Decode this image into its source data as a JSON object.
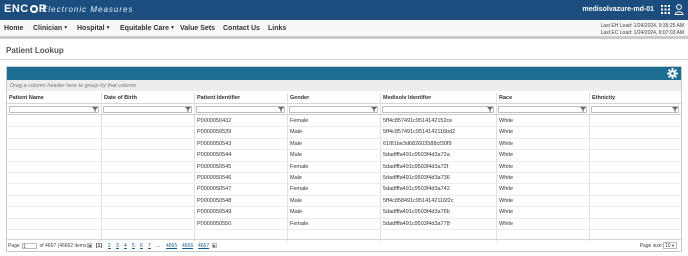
{
  "app": {
    "logo": "ENC",
    "logo_tail": "R",
    "subtitle": "Electronic Measures",
    "tenant": "medisolvazure-md-01"
  },
  "nav": {
    "items": [
      {
        "label": "Home",
        "has_caret": false
      },
      {
        "label": "Clinician",
        "has_caret": true
      },
      {
        "label": "Hospital",
        "has_caret": true
      },
      {
        "label": "Equitable Care",
        "has_caret": true
      },
      {
        "label": "Value Sets",
        "has_caret": false
      },
      {
        "label": "Contact Us",
        "has_caret": false
      },
      {
        "label": "Links",
        "has_caret": false
      }
    ],
    "last_eh_load": "Last EH Load: 1/24/2024, 9:35:25 AM",
    "last_ec_load": "Last EC Load: 1/24/2024, 6:07:03 AM"
  },
  "page": {
    "title": "Patient Lookup"
  },
  "grid": {
    "group_hint": "Drag a column header here to group by that column",
    "columns": [
      "Patient Name",
      "Date of Birth",
      "Patient Identifier",
      "Gender",
      "Medisolv Identifier",
      "Race",
      "Ethnicity"
    ],
    "rows": [
      {
        "name": "",
        "dob": "",
        "pid": "P0000050432",
        "gender": "Female",
        "mid": "5ff4c857491c9514142152ce",
        "race": "White",
        "eth": ""
      },
      {
        "name": "",
        "dob": "",
        "pid": "P0000050539",
        "gender": "Male",
        "mid": "5ff4c857491c9514142116bd2",
        "race": "White",
        "eth": ""
      },
      {
        "name": "",
        "dob": "",
        "pid": "P0000050543",
        "gender": "Male",
        "mid": "61f81be3d682603588cf30f9",
        "race": "White",
        "eth": ""
      },
      {
        "name": "",
        "dob": "",
        "pid": "P0000050544",
        "gender": "Male",
        "mid": "5dadfffa491c9503f4d3a72a",
        "race": "White",
        "eth": ""
      },
      {
        "name": "",
        "dob": "",
        "pid": "P0000050545",
        "gender": "Female",
        "mid": "5dadfffa491c9503f4d3a72f",
        "race": "White",
        "eth": ""
      },
      {
        "name": "",
        "dob": "",
        "pid": "P0000050546",
        "gender": "Male",
        "mid": "5dadfffa491c9503f4d3a736",
        "race": "White",
        "eth": ""
      },
      {
        "name": "",
        "dob": "",
        "pid": "P0000050547",
        "gender": "Female",
        "mid": "5dadfffa491c9503f4d3a742",
        "race": "White",
        "eth": ""
      },
      {
        "name": "",
        "dob": "",
        "pid": "P0000050548",
        "gender": "Male",
        "mid": "5ff4c858491c9514142116f2c",
        "race": "White",
        "eth": ""
      },
      {
        "name": "",
        "dob": "",
        "pid": "P0000050549",
        "gender": "Male",
        "mid": "5dadfffa491c9503f4d3a76b",
        "race": "White",
        "eth": ""
      },
      {
        "name": "",
        "dob": "",
        "pid": "P0000050550",
        "gender": "Female",
        "mid": "5dadfffa491c9503f4d3a778",
        "race": "White",
        "eth": ""
      }
    ]
  },
  "pager": {
    "page_label": "Page",
    "page_value": "1",
    "of_text": "of 4667 (46662 items )",
    "current": "[1]",
    "pages": [
      "2",
      "3",
      "4",
      "5",
      "6",
      "7",
      "...",
      "4665",
      "4666",
      "4667"
    ],
    "page_size_label": "Page size:",
    "page_size": "10"
  },
  "colors": {
    "topbar": "#1b4e7e",
    "grid_toolbar": "#1d6d93"
  },
  "icons": [
    "grid-menu-icon",
    "user-icon",
    "gear-icon",
    "filter-icon",
    "prev-icon",
    "next-icon",
    "dropdown-icon"
  ]
}
